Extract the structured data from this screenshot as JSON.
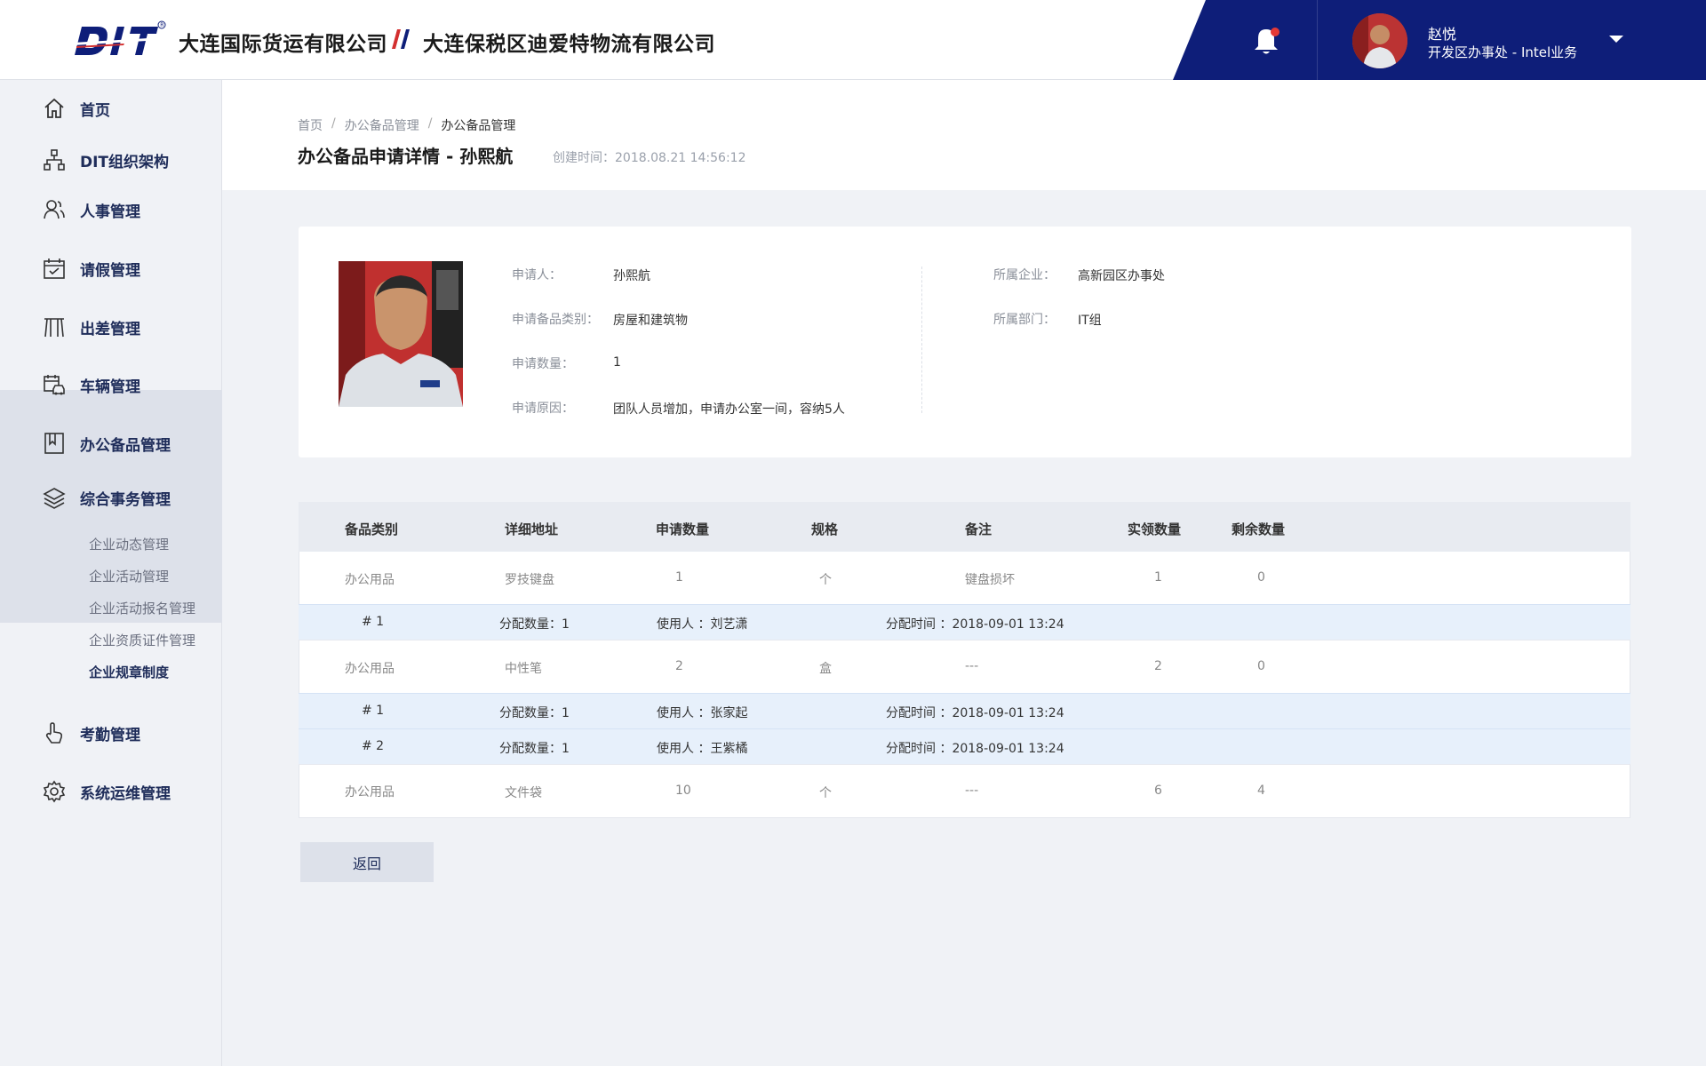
{
  "header": {
    "company1": "大连国际货运有限公司",
    "company2": "大连保税区迪爱特物流有限公司",
    "logo_text": "DIT",
    "user_name": "赵悦",
    "user_dept": "开发区办事处 - Intel业务",
    "brand_color": "#0e1e79",
    "notify_color": "#e53935"
  },
  "sidebar": {
    "items": [
      {
        "label": "首页",
        "icon": "home-icon"
      },
      {
        "label": "DIT组织架构",
        "icon": "org-chart-icon"
      },
      {
        "label": "人事管理",
        "icon": "people-icon"
      },
      {
        "label": "请假管理",
        "icon": "calendar-icon"
      },
      {
        "label": "出差管理",
        "icon": "gate-icon"
      },
      {
        "label": "车辆管理",
        "icon": "car-icon"
      },
      {
        "label": "办公备品管理",
        "icon": "bookmark-icon"
      },
      {
        "label": "综合事务管理",
        "icon": "layers-icon"
      },
      {
        "label": "考勤管理",
        "icon": "hand-icon"
      },
      {
        "label": "系统运维管理",
        "icon": "gear-icon"
      }
    ],
    "sub_items": [
      "企业动态管理",
      "企业活动管理",
      "企业活动报名管理",
      "企业资质证件管理",
      "企业规章制度"
    ],
    "active_sub": "企业规章制度"
  },
  "breadcrumb": [
    "首页",
    "办公备品管理",
    "办公备品管理"
  ],
  "page": {
    "title": "办公备品申请详情  -  孙熙航",
    "created": "创建时间：2018.08.21   14:56:12"
  },
  "info": {
    "applicant_label": "申请人：",
    "applicant": "孙熙航",
    "category_label": "申请备品类别：",
    "category": "房屋和建筑物",
    "qty_label": "申请数量：",
    "qty": "1",
    "reason_label": "申请原因：",
    "reason": "团队人员增加，申请办公室一间，容纳5人",
    "company_label": "所属企业：",
    "company": "高新园区办事处",
    "dept_label": "所属部门：",
    "dept": "IT组"
  },
  "table": {
    "headers": [
      "备品类别",
      "详细地址",
      "申请数量",
      "规格",
      "备注",
      "实领数量",
      "剩余数量"
    ],
    "rows": [
      {
        "category": "办公用品",
        "name": "罗技键盘",
        "qty": "1",
        "unit": "个",
        "note": "键盘损坏",
        "received": "1",
        "remain": "0",
        "allocs": [
          {
            "no": "# 1",
            "count": "分配数量：1",
            "user": "使用人  ：刘艺潇",
            "time": "分配时间  ：2018-09-01 13:24"
          }
        ]
      },
      {
        "category": "办公用品",
        "name": "中性笔",
        "qty": "2",
        "unit": "盒",
        "note": "---",
        "received": "2",
        "remain": "0",
        "allocs": [
          {
            "no": "# 1",
            "count": "分配数量：1",
            "user": "使用人  ：张家起",
            "time": "分配时间  ：2018-09-01 13:24"
          },
          {
            "no": "# 2",
            "count": "分配数量：1",
            "user": "使用人  ：王紫橘",
            "time": "分配时间  ：2018-09-01 13:24"
          }
        ]
      },
      {
        "category": "办公用品",
        "name": "文件袋",
        "qty": "10",
        "unit": "个",
        "note": "---",
        "received": "6",
        "remain": "4",
        "allocs": []
      }
    ]
  },
  "back_label": "返回"
}
